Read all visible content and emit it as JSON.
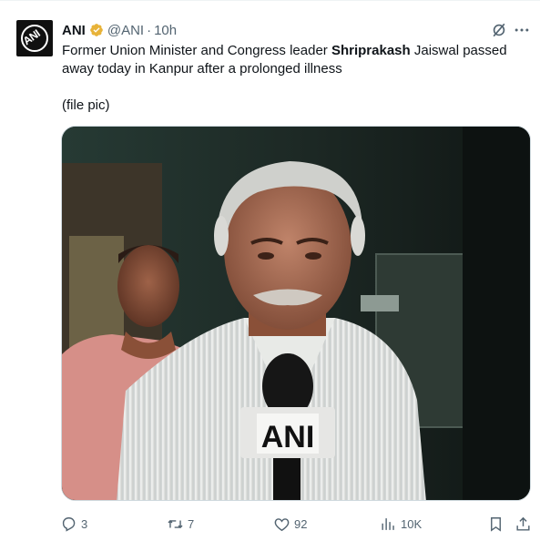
{
  "tweet": {
    "author_name": "ANI",
    "handle": "@ANI",
    "separator": "·",
    "time": "10h",
    "avatar_text": "ANI",
    "text_before": "Former Union Minister and Congress leader ",
    "text_bold": "Shriprakash",
    "text_after": " Jaiswal passed away today in Kanpur after a prolonged illness",
    "file_pic": "(file pic)",
    "image": {
      "mic_label": "ANI"
    }
  },
  "actions": {
    "replies": "3",
    "reposts": "7",
    "likes": "92",
    "views": "10K"
  },
  "colors": {
    "verified": "#e8b339",
    "muted": "#536471",
    "text": "#0f1419"
  }
}
